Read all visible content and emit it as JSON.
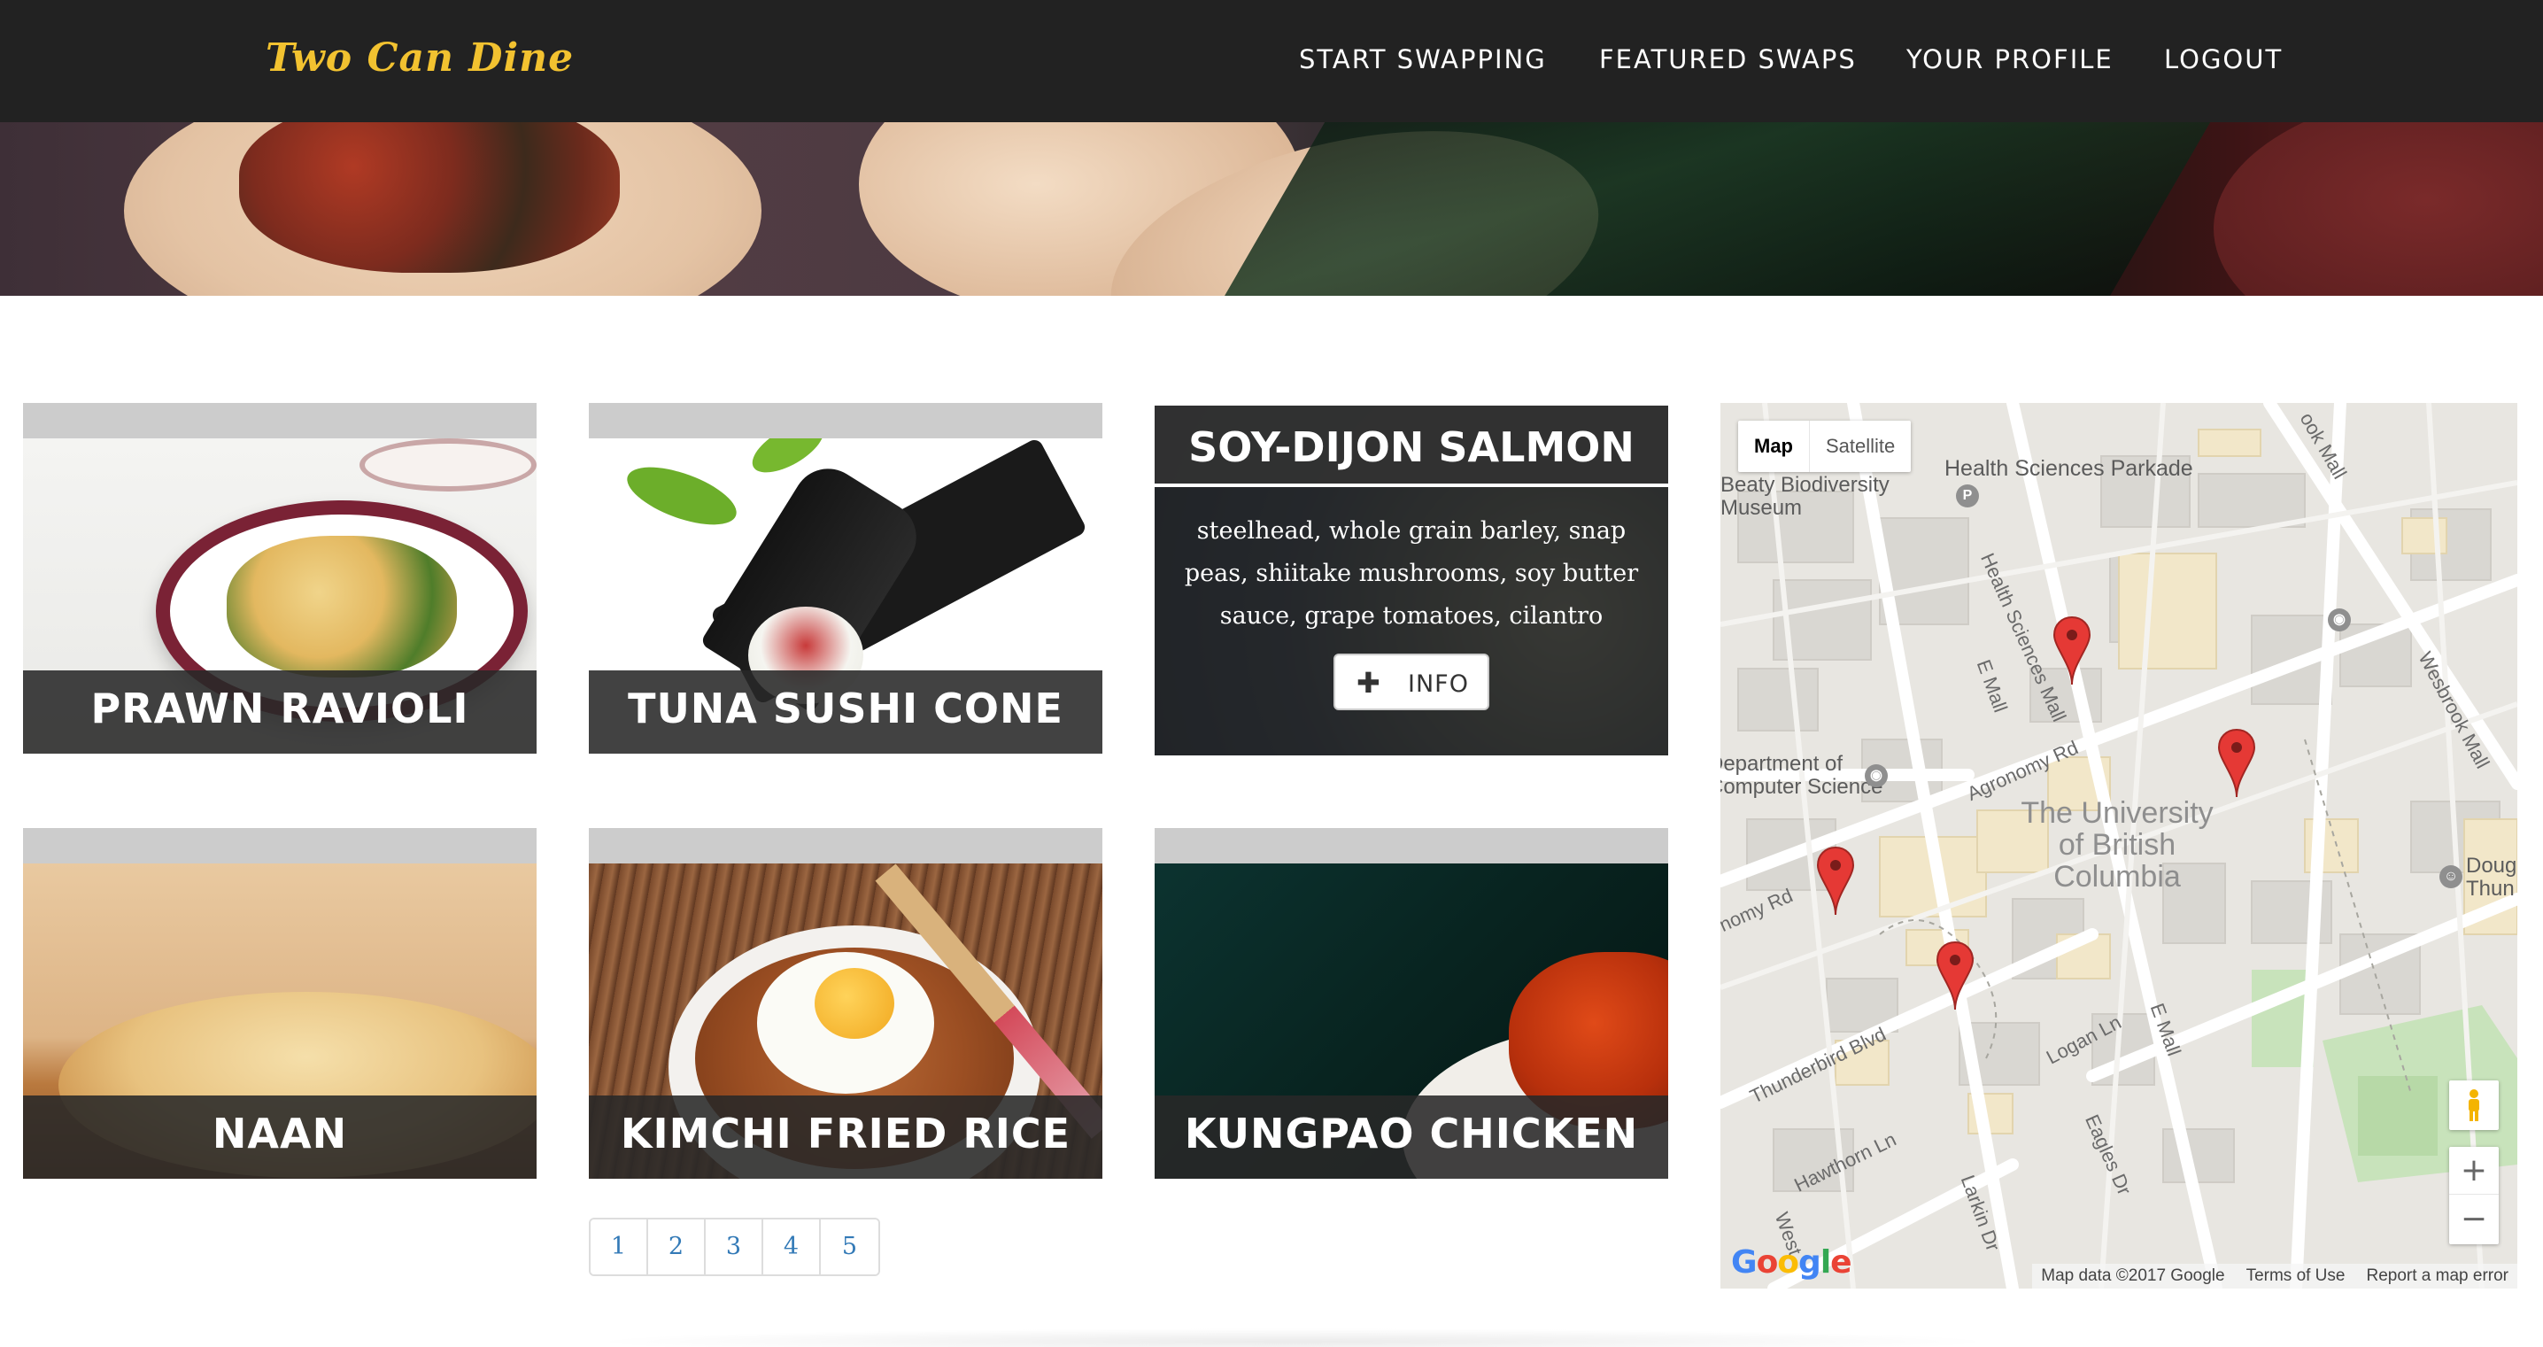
{
  "brand": "Two Can Dine",
  "nav": [
    {
      "label": "START SWAPPING"
    },
    {
      "label": "FEATURED SWAPS"
    },
    {
      "label": "YOUR PROFILE"
    },
    {
      "label": "LOGOUT"
    }
  ],
  "cards": [
    {
      "title": "PRAWN RAVIOLI"
    },
    {
      "title": "TUNA SUSHI CONE"
    },
    {
      "title": "SOY-DIJON SALMON",
      "description": "steelhead, whole grain barley, snap peas, shiitake mushrooms, soy butter sauce, grape tomatoes, cilantro",
      "button_icon": "plus-icon",
      "button_label": "INFO"
    },
    {
      "title": "NAAN"
    },
    {
      "title": "KIMCHI FRIED RICE"
    },
    {
      "title": "KUNGPAO CHICKEN"
    }
  ],
  "pagination": [
    "1",
    "2",
    "3",
    "4",
    "5"
  ],
  "map": {
    "type_map": "Map",
    "type_satellite": "Satellite",
    "places": {
      "health_parkade": "Health Sciences Parkade",
      "beaty": "Beaty Biodiversity\nMuseum",
      "dept_cs": "Department of\nComputer Science",
      "ubc": "The University\nof British\nColumbia",
      "doug": "Doug\nThun"
    },
    "streets": {
      "health_mall": "Health Sciences Mall",
      "e_mall": "E Mall",
      "agronomy": "Agronomy Rd",
      "agronomy_w": "nomy Rd",
      "wesbrook": "Wesbrook Mall",
      "thunderbird": "Thunderbird Blvd",
      "logan": "Logan Ln",
      "e_mall_2": "E Mall",
      "hawthorn": "Hawthorn Ln",
      "larkin": "Larkin Dr",
      "eagles": "Eagles Dr",
      "ook_mall": "ook Mall",
      "west": "West"
    },
    "zoom_in": "+",
    "zoom_out": "−",
    "logo": "Google",
    "attribution": [
      "Map data ©2017 Google",
      "Terms of Use",
      "Report a map error"
    ],
    "pin_color": "#e53935"
  },
  "colors": {
    "navbar": "#222222",
    "brand": "#f2c230",
    "link": "#337ab7"
  }
}
